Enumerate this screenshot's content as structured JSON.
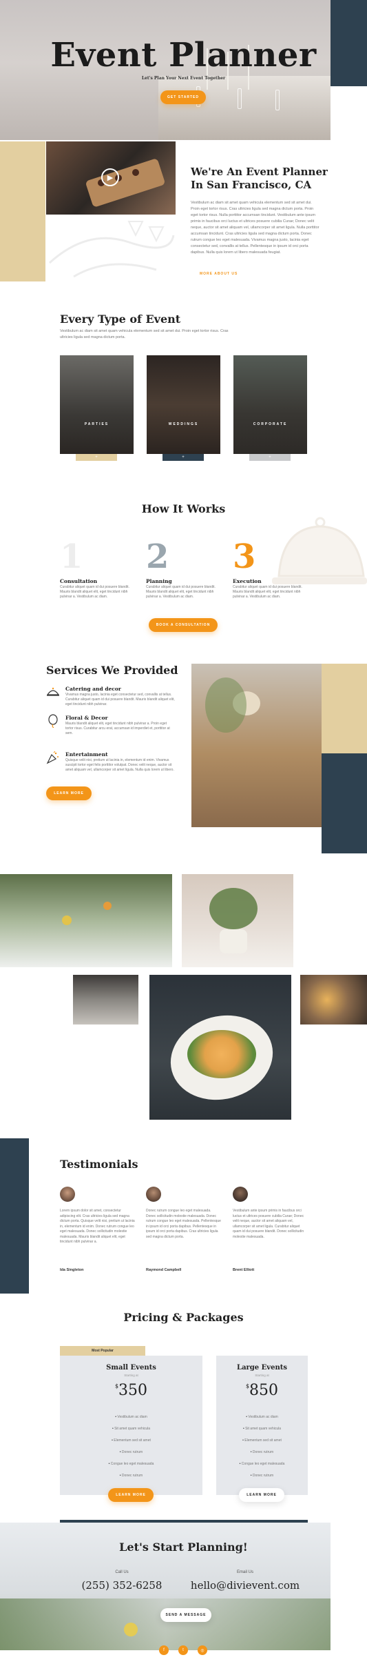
{
  "hero": {
    "title": "Event Planner",
    "subtitle": "Let's Plan Your Next Event Together",
    "cta_label": "GET STARTED"
  },
  "about": {
    "title_line1": "We're An Event Planner",
    "title_line2": "In San Francisco, CA",
    "body": "Vestibulum ac diam sit amet quam vehicula elementum sed sit amet dui. Proin eget tortor risus. Cras ultricies ligula sed magna dictum porta. Proin eget tortor risus. Nulla porttitor accumsan tincidunt. Vestibulum ante ipsum primis in faucibus orci luctus et ultrices posuere cubilia Curae; Donec velit neque, auctor sit amet aliquam vel, ullamcorper sit amet ligula. Nulla porttitor accumsan tincidunt. Cras ultricies ligula sed magna dictum porta. Donec rutrum congue leo eget malesuada. Vivamus magna justo, lacinia eget consectetur sed, convallis at tellus. Pellentesque in ipsum id orci porta dapibus. Nulla quis lorem ut libero malesuada feugiat.",
    "link_label": "MORE ABOUT US",
    "play_icon": "play-icon"
  },
  "types": {
    "title": "Every Type of Event",
    "body": "Vestibulum ac diam sit amet quam vehicula elementum sed sit amet dui. Proin eget tortor risus. Cras ultricies ligula sed magna dictum porta.",
    "cards": [
      {
        "label": "PARTIES",
        "bar_color": "#e3cfa0",
        "bar_glyph": "+"
      },
      {
        "label": "WEDDINGS",
        "bar_color": "#2e4150",
        "bar_glyph": "+"
      },
      {
        "label": "CORPORATE",
        "bar_color": "#c9cacc",
        "bar_glyph": "+"
      }
    ]
  },
  "how": {
    "title": "How It Works",
    "steps": [
      {
        "num": "1",
        "title": "Consultation",
        "body": "Curabitur aliquet quam id dui posuere blandit. Mauris blandit aliquet elit, eget tincidunt nibh pulvinar a. Vestibulum ac diam."
      },
      {
        "num": "2",
        "title": "Planning",
        "body": "Curabitur aliquet quam id dui posuere blandit. Mauris blandit aliquet elit, eget tincidunt nibh pulvinar a. Vestibulum ac diam."
      },
      {
        "num": "3",
        "title": "Execution",
        "body": "Curabitur aliquet quam id dui posuere blandit. Mauris blandit aliquet elit, eget tincidunt nibh pulvinar a. Vestibulum ac diam."
      }
    ],
    "cta_label": "BOOK A CONSULTATION"
  },
  "services": {
    "title": "Services We Provided",
    "items": [
      {
        "title": "Catering and decor",
        "icon": "catering-icon",
        "body": "Vivamus magna justo, lacinia eget consectetur sed, convallis at tellus. Curabitur aliquet quam id dui posuere blandit. Mauris blandit aliquet elit, eget tincidunt nibh pulvinar."
      },
      {
        "title": "Floral & Decor",
        "icon": "balloon-icon",
        "body": "Mauris blandit aliquet elit, eget tincidunt nibh pulvinar a. Proin eget tortor risus. Curabitur arcu erat, accumsan id imperdiet et, porttitor at sem."
      },
      {
        "title": "Entertainment",
        "icon": "party-popper-icon",
        "body": "Quisque velit nisi, pretium ut lacinia in, elementum id enim. Vivamus suscipit tortor eget felis porttitor volutpat. Donec velit neque, auctor sit amet aliquam vel, ullamcorper sit amet ligula. Nulla quis lorem ut libero."
      }
    ],
    "cta_label": "LEARN MORE"
  },
  "testimonials": {
    "title": "Testimonials",
    "items": [
      {
        "name": "Ida Singleton",
        "body": "Lorem ipsum dolor sit amet, consectetur adipiscing elit. Cras ultricies ligula sed magna dictum porta. Quisque velit nisi, pretium ut lacinia in, elementum id enim. Donec rutrum congue leo eget malesuada. Donec sollicitudin molestie malesuada. Mauris blandit aliquet elit, eget tincidunt nibh pulvinar a."
      },
      {
        "name": "Raymond Campbell",
        "body": "Donec rutrum congue leo eget malesuada. Donec sollicitudin molestie malesuada. Donec rutrum congue leo eget malesuada. Pellentesque in ipsum id orci porta dapibus. Pellentesque in ipsum id orci porta dapibus. Cras ultricies ligula sed magna dictum porta."
      },
      {
        "name": "Brent Elliott",
        "body": "Vestibulum ante ipsum primis in faucibus orci luctus et ultrices posuere cubilia Curae; Donec velit neque, auctor sit amet aliquam vel, ullamcorper sit amet ligula. Curabitur aliquet quam id dui posuere blandit. Donec sollicitudin molestie malesuada."
      }
    ]
  },
  "pricing": {
    "title": "Pricing & Packages",
    "badge": "Most Popular",
    "plans": [
      {
        "title": "Small Events",
        "sub": "Starting at",
        "currency": "$",
        "price": "350",
        "features": [
          "Vestibulum ac diam",
          "Sit amet quam vehicula",
          "Elementum sed sit amet",
          "Donec rutrum",
          "Congue leo eget malesuada",
          "Donec rutrum"
        ],
        "cta": "LEARN MORE"
      },
      {
        "title": "Large Events",
        "sub": "Starting at",
        "currency": "$",
        "price": "850",
        "features": [
          "Vestibulum ac diam",
          "Sit amet quam vehicula",
          "Elementum sed sit amet",
          "Donec rutrum",
          "Congue leo eget malesuada",
          "Donec rutrum"
        ],
        "cta": "LEARN MORE"
      }
    ]
  },
  "footer": {
    "title": "Let's Start Planning!",
    "call_label": "Call Us",
    "phone": "(255) 352-6258",
    "email_label": "Email Us",
    "email": "hello@divievent.com",
    "cta_label": "SEND A MESSAGE",
    "socials": [
      {
        "icon": "facebook-icon",
        "glyph": "f"
      },
      {
        "icon": "twitter-icon",
        "glyph": "t"
      },
      {
        "icon": "instagram-icon",
        "glyph": "◎"
      }
    ]
  },
  "colors": {
    "accent": "#f39519",
    "navy": "#2e4150",
    "tan": "#e3cfa0"
  }
}
